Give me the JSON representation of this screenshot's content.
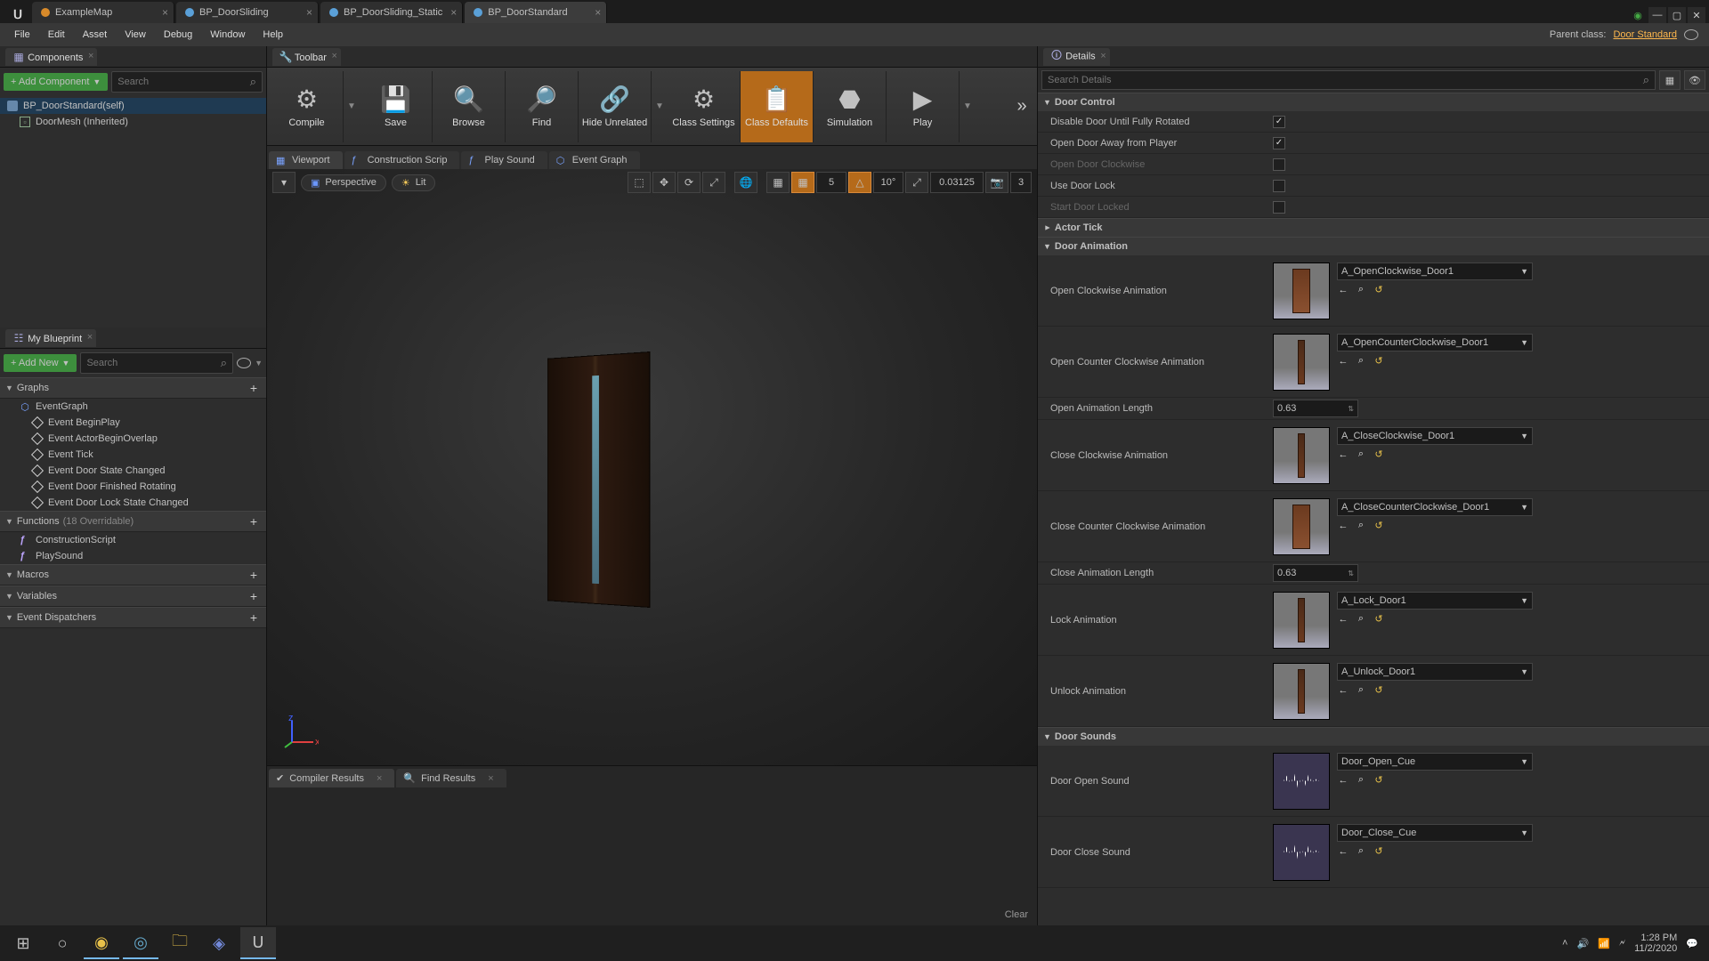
{
  "tabs": [
    "ExampleMap",
    "BP_DoorSliding",
    "BP_DoorSliding_Static",
    "BP_DoorStandard"
  ],
  "active_tab": 3,
  "menu": [
    "File",
    "Edit",
    "Asset",
    "View",
    "Debug",
    "Window",
    "Help"
  ],
  "parent_class_label": "Parent class:",
  "parent_class_value": "Door Standard",
  "panels": {
    "components": "Components",
    "toolbar": "Toolbar",
    "details": "Details",
    "myblueprint": "My Blueprint"
  },
  "components_panel": {
    "add_btn": "+ Add Component",
    "search_placeholder": "Search",
    "tree": [
      {
        "name": "BP_DoorStandard(self)",
        "sel": true
      },
      {
        "name": "DoorMesh (Inherited)",
        "indent": true
      }
    ]
  },
  "myblueprint": {
    "add_btn": "+ Add New",
    "search_placeholder": "Search",
    "sections": [
      {
        "name": "Graphs",
        "items": [
          {
            "name": "EventGraph",
            "icon": "graph"
          },
          {
            "name": "Event BeginPlay",
            "icon": "diamond",
            "sub": true
          },
          {
            "name": "Event ActorBeginOverlap",
            "icon": "diamond",
            "sub": true
          },
          {
            "name": "Event Tick",
            "icon": "diamond",
            "sub": true
          },
          {
            "name": "Event Door State Changed",
            "icon": "diamond",
            "sub": true
          },
          {
            "name": "Event Door Finished Rotating",
            "icon": "diamond",
            "sub": true
          },
          {
            "name": "Event Door Lock State Changed",
            "icon": "diamond",
            "sub": true
          }
        ]
      },
      {
        "name": "Functions",
        "suffix": "(18 Overridable)",
        "items": [
          {
            "name": "ConstructionScript",
            "icon": "fn"
          },
          {
            "name": "PlaySound",
            "icon": "fn"
          }
        ]
      },
      {
        "name": "Macros",
        "items": []
      },
      {
        "name": "Variables",
        "items": []
      },
      {
        "name": "Event Dispatchers",
        "items": []
      }
    ]
  },
  "toolbar": [
    {
      "label": "Compile",
      "caret": true
    },
    {
      "label": "Save"
    },
    {
      "label": "Browse"
    },
    {
      "label": "Find"
    },
    {
      "label": "Hide Unrelated",
      "caret": true
    },
    {
      "label": "Class Settings"
    },
    {
      "label": "Class Defaults",
      "active": true
    },
    {
      "label": "Simulation"
    },
    {
      "label": "Play",
      "caret": true
    }
  ],
  "subtabs": [
    "Viewport",
    "Construction Scrip",
    "Play Sound",
    "Event Graph"
  ],
  "viewport": {
    "perspective": "Perspective",
    "lit": "Lit",
    "grid_val": "5",
    "angle_val": "10°",
    "scale_val": "0.03125",
    "cam_val": "3"
  },
  "results_tabs": [
    "Compiler Results",
    "Find Results"
  ],
  "results_clear": "Clear",
  "details": {
    "search_placeholder": "Search Details",
    "categories": [
      {
        "name": "Door Control",
        "type": "checks",
        "rows": [
          {
            "label": "Disable Door Until Fully Rotated",
            "checked": true
          },
          {
            "label": "Open Door Away from Player",
            "checked": true
          },
          {
            "label": "Open Door Clockwise",
            "checked": false,
            "dim": true
          },
          {
            "label": "Use Door Lock",
            "checked": false
          },
          {
            "label": "Start Door Locked",
            "checked": false,
            "dim": true
          }
        ]
      },
      {
        "name": "Actor Tick",
        "type": "collapsed"
      },
      {
        "name": "Door Animation",
        "type": "anim",
        "rows": [
          {
            "label": "Open Clockwise Animation",
            "asset": "A_OpenClockwise_Door1",
            "thumb": "door-t"
          },
          {
            "label": "Open Counter Clockwise Animation",
            "asset": "A_OpenCounterClockwise_Door1",
            "thumb": "door-closed"
          },
          {
            "label": "Open Animation Length",
            "num": "0.63"
          },
          {
            "label": "Close Clockwise Animation",
            "asset": "A_CloseClockwise_Door1",
            "thumb": "door-closed"
          },
          {
            "label": "Close Counter Clockwise Animation",
            "asset": "A_CloseCounterClockwise_Door1",
            "thumb": "door-t"
          },
          {
            "label": "Close Animation Length",
            "num": "0.63"
          },
          {
            "label": "Lock Animation",
            "asset": "A_Lock_Door1",
            "thumb": "door-closed"
          },
          {
            "label": "Unlock Animation",
            "asset": "A_Unlock_Door1",
            "thumb": "door-closed"
          }
        ]
      },
      {
        "name": "Door Sounds",
        "type": "anim",
        "rows": [
          {
            "label": "Door Open Sound",
            "asset": "Door_Open_Cue",
            "thumb": "sound"
          },
          {
            "label": "Door Close Sound",
            "asset": "Door_Close_Cue",
            "thumb": "sound"
          }
        ]
      }
    ]
  },
  "taskbar": {
    "time": "1:28 PM",
    "date": "11/2/2020"
  }
}
